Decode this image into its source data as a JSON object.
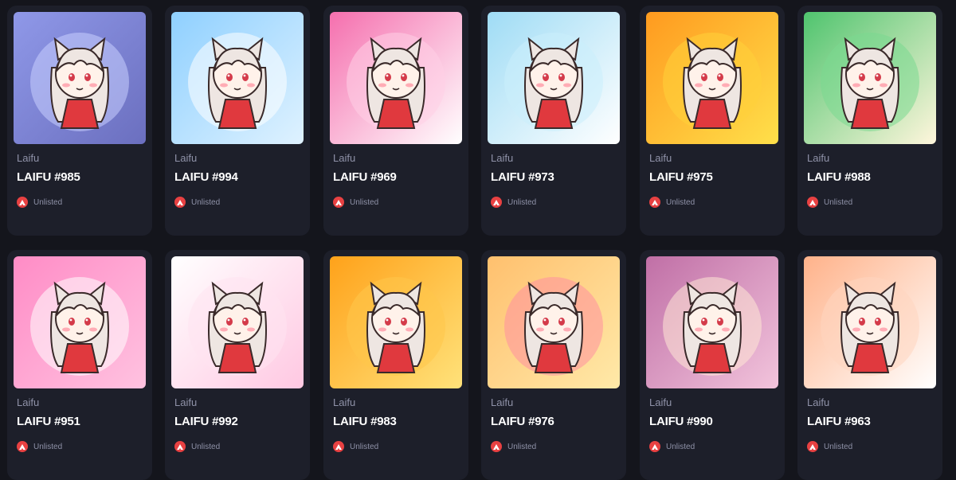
{
  "cards": [
    {
      "collection": "Laifu",
      "title": "LAIFU #985",
      "status": "Unlisted",
      "bg1": "#8f98e8",
      "bg2": "#6b6fbf",
      "accent": "#c9cfff"
    },
    {
      "collection": "Laifu",
      "title": "LAIFU #994",
      "status": "Unlisted",
      "bg1": "#8fd0ff",
      "bg2": "#dff2ff",
      "accent": "#ffffff"
    },
    {
      "collection": "Laifu",
      "title": "LAIFU #969",
      "status": "Unlisted",
      "bg1": "#f56fae",
      "bg2": "#ffffff",
      "accent": "#ffd0e6"
    },
    {
      "collection": "Laifu",
      "title": "LAIFU #973",
      "status": "Unlisted",
      "bg1": "#9fdcf5",
      "bg2": "#ffffff",
      "accent": "#cbeefc"
    },
    {
      "collection": "Laifu",
      "title": "LAIFU #975",
      "status": "Unlisted",
      "bg1": "#ff9a1f",
      "bg2": "#ffe04a",
      "accent": "#ffd23a"
    },
    {
      "collection": "Laifu",
      "title": "LAIFU #988",
      "status": "Unlisted",
      "bg1": "#4fc46e",
      "bg2": "#fff6dc",
      "accent": "#7ad890"
    },
    {
      "collection": "Laifu",
      "title": "LAIFU #951",
      "status": "Unlisted",
      "bg1": "#ff8cc6",
      "bg2": "#ffc2e0",
      "accent": "#ffffff"
    },
    {
      "collection": "Laifu",
      "title": "LAIFU #992",
      "status": "Unlisted",
      "bg1": "#ffffff",
      "bg2": "#ffc8e2",
      "accent": "#ffe3f0"
    },
    {
      "collection": "Laifu",
      "title": "LAIFU #983",
      "status": "Unlisted",
      "bg1": "#ffa21a",
      "bg2": "#ffe27a",
      "accent": "#ffc64a"
    },
    {
      "collection": "Laifu",
      "title": "LAIFU #976",
      "status": "Unlisted",
      "bg1": "#ffc06e",
      "bg2": "#ffe9a8",
      "accent": "#ff8fa0"
    },
    {
      "collection": "Laifu",
      "title": "LAIFU #990",
      "status": "Unlisted",
      "bg1": "#c06fa6",
      "bg2": "#f2c4dc",
      "accent": "#ffe7d6"
    },
    {
      "collection": "Laifu",
      "title": "LAIFU #963",
      "status": "Unlisted",
      "bg1": "#ffb28a",
      "bg2": "#ffffff",
      "accent": "#ffd6c0"
    }
  ]
}
